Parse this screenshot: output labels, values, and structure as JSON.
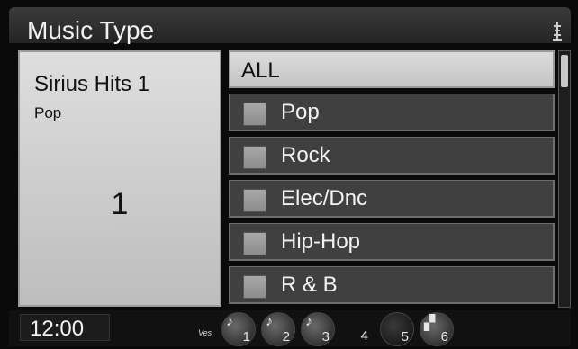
{
  "header": {
    "title": "Music Type",
    "status_icon": "antenna-icon"
  },
  "now_playing": {
    "channel_name": "Sirius Hits 1",
    "genre": "Pop",
    "channel_number": "1"
  },
  "categories": [
    {
      "label": "ALL",
      "selected": true
    },
    {
      "label": "Pop",
      "checked": false
    },
    {
      "label": "Rock",
      "checked": false
    },
    {
      "label": "Elec/Dnc",
      "checked": false
    },
    {
      "label": "Hip-Hop",
      "checked": false
    },
    {
      "label": "R & B",
      "checked": false
    }
  ],
  "status_bar": {
    "clock": "12:00",
    "ves_label": "Ves",
    "presets": [
      {
        "number": "1",
        "icon": "music-disc-icon"
      },
      {
        "number": "2",
        "icon": "music-note-icon"
      },
      {
        "number": "3",
        "icon": "music-note-icon"
      },
      {
        "number": "4",
        "icon": ""
      },
      {
        "number": "5",
        "icon": ""
      },
      {
        "number": "6",
        "icon": "clapperboard-icon"
      }
    ]
  }
}
